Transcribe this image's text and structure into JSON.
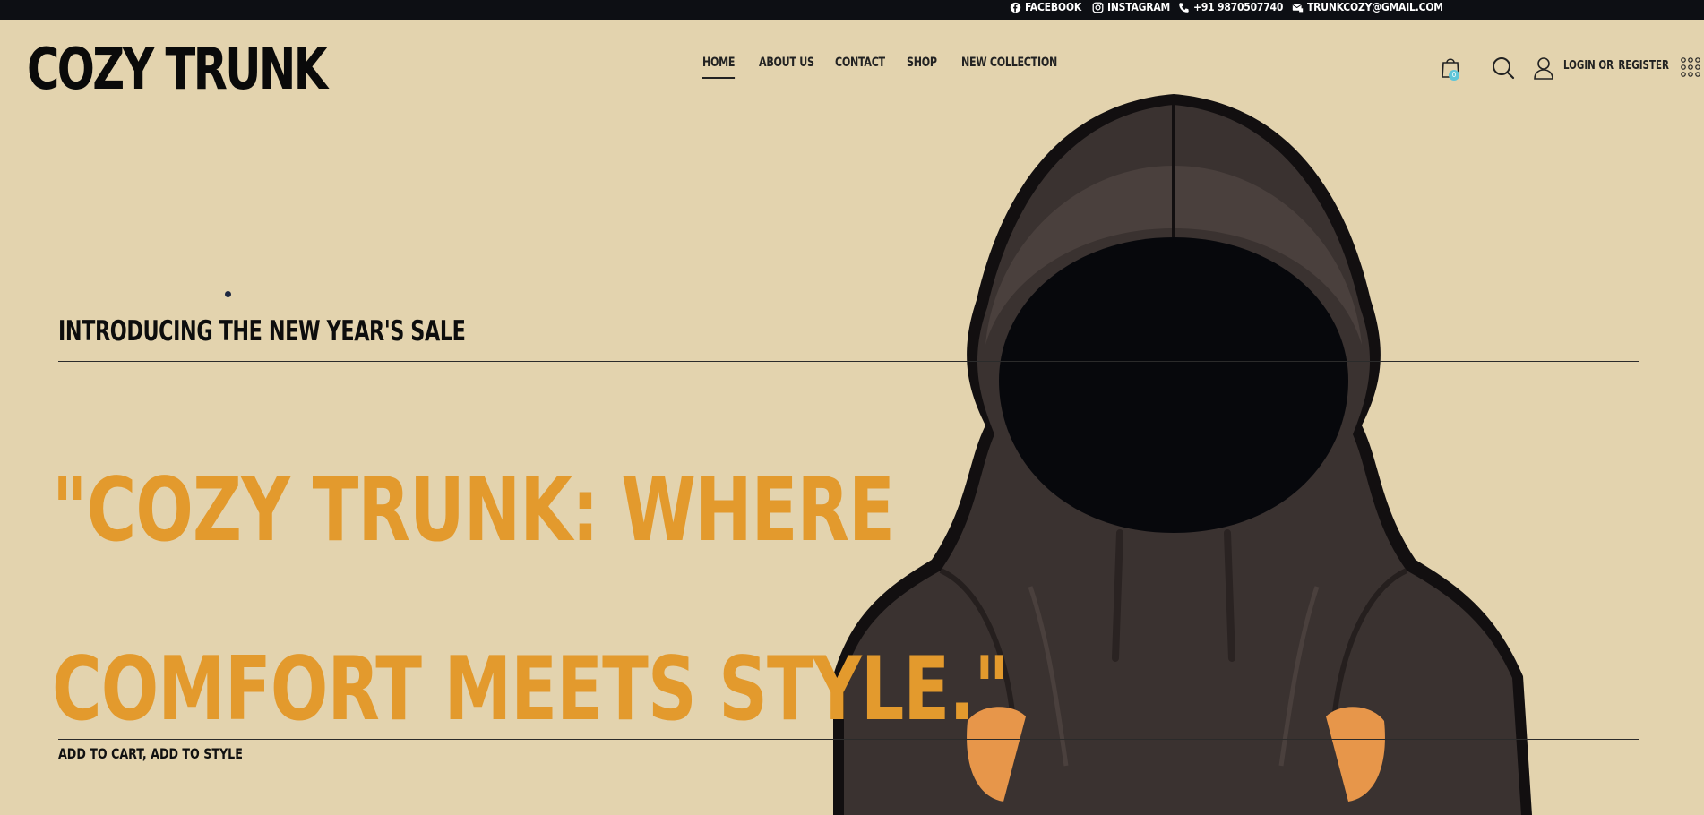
{
  "topbar": {
    "facebook": {
      "label": "FACEBOOK",
      "icon": "facebook-icon"
    },
    "instagram": {
      "label": "INSTAGRAM",
      "icon": "instagram-icon"
    },
    "phone": {
      "label": "+91 9870507740",
      "icon": "phone-icon"
    },
    "email": {
      "label": "TRUNKCOZY@GMAIL.COM",
      "icon": "email-icon"
    }
  },
  "header": {
    "logo": "COZY TRUNK",
    "nav": [
      {
        "label": "HOME",
        "active": true
      },
      {
        "label": "ABOUT US",
        "active": false
      },
      {
        "label": "CONTACT",
        "active": false
      },
      {
        "label": "SHOP",
        "active": false
      },
      {
        "label": "NEW COLLECTION",
        "active": false
      }
    ],
    "cart_count": "0",
    "login_label": "LOGIN OR",
    "register_label": "REGISTER"
  },
  "hero": {
    "eyebrow": "INTRODUCING THE NEW YEAR'S SALE",
    "headline": "\"COZY TRUNK: WHERE COMFORT MEETS STYLE.\"",
    "tagline": "ADD TO CART, ADD TO STYLE"
  },
  "colors": {
    "background": "#e3d3ae",
    "topbar": "#0d0f14",
    "accent_orange": "#e39a2d",
    "badge": "#5ec6d8",
    "hoodie": "#3a3230"
  }
}
